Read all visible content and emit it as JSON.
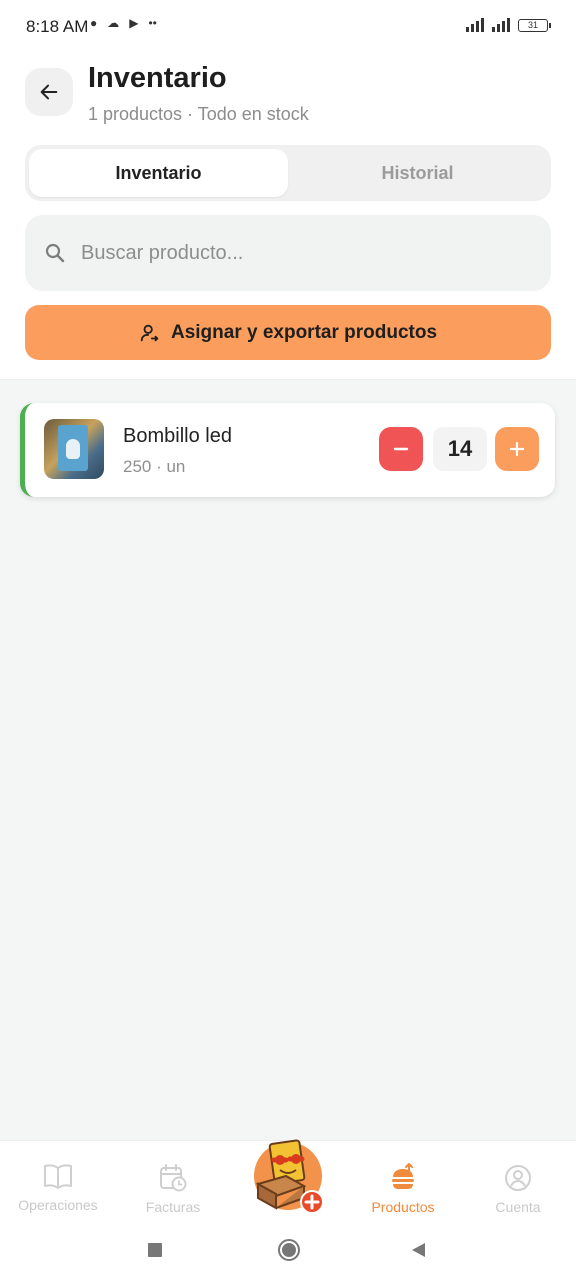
{
  "status_bar": {
    "time": "8:18 AM",
    "battery": "31"
  },
  "header": {
    "title": "Inventario",
    "subtitle": "1 productos · Todo en stock"
  },
  "tabs": [
    {
      "label": "Inventario",
      "active": true
    },
    {
      "label": "Historial",
      "active": false
    }
  ],
  "search": {
    "placeholder": "Buscar producto...",
    "value": ""
  },
  "assign_button": {
    "label": "Asignar y exportar productos"
  },
  "products": [
    {
      "name": "Bombillo led",
      "meta": "250 · un",
      "quantity": "14",
      "stock_color": "#4caf50"
    }
  ],
  "bottom_nav": [
    {
      "label": "Operaciones",
      "icon": "book-open-icon",
      "active": false
    },
    {
      "label": "Facturas",
      "icon": "calendar-clock-icon",
      "active": false
    },
    {
      "label": "",
      "icon": "add-product-fab-icon",
      "active": false
    },
    {
      "label": "Productos",
      "icon": "burger-icon",
      "active": true
    },
    {
      "label": "Cuenta",
      "icon": "user-circle-icon",
      "active": false
    }
  ],
  "colors": {
    "accent": "#fb9d5c",
    "danger": "#f05454",
    "success": "#4caf50"
  }
}
